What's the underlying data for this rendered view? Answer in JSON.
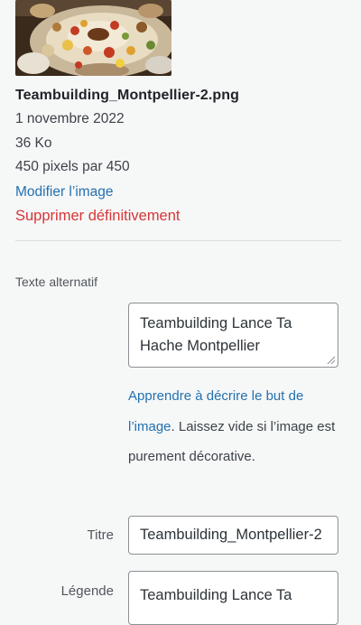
{
  "attachment": {
    "thumbnail_alt": "Teambuilding_Montpellier-2.png",
    "file_name": "Teambuilding_Montpellier-2.png",
    "date": "1 novembre 2022",
    "size": "36 Ko",
    "dimensions": "450 pixels par 450",
    "edit_link": "Modifier l’image",
    "delete_link": "Supprimer définitivement"
  },
  "fields": {
    "alt": {
      "label": "Texte alternatif",
      "value": "Teambuilding Lance Ta Hache Montpellier",
      "help_link": "Apprendre à décrire le but de l’image",
      "help_text": ". Laissez vide si l’image est purement décorative."
    },
    "title": {
      "label": "Titre",
      "value": "Teambuilding_Montpellier-2"
    },
    "caption": {
      "label": "Légende",
      "value": "Teambuilding Lance Ta"
    }
  },
  "colors": {
    "link": "#2271b1",
    "delete": "#d63638",
    "panel_bg": "#f6f7f7",
    "border": "#8c8f94"
  }
}
